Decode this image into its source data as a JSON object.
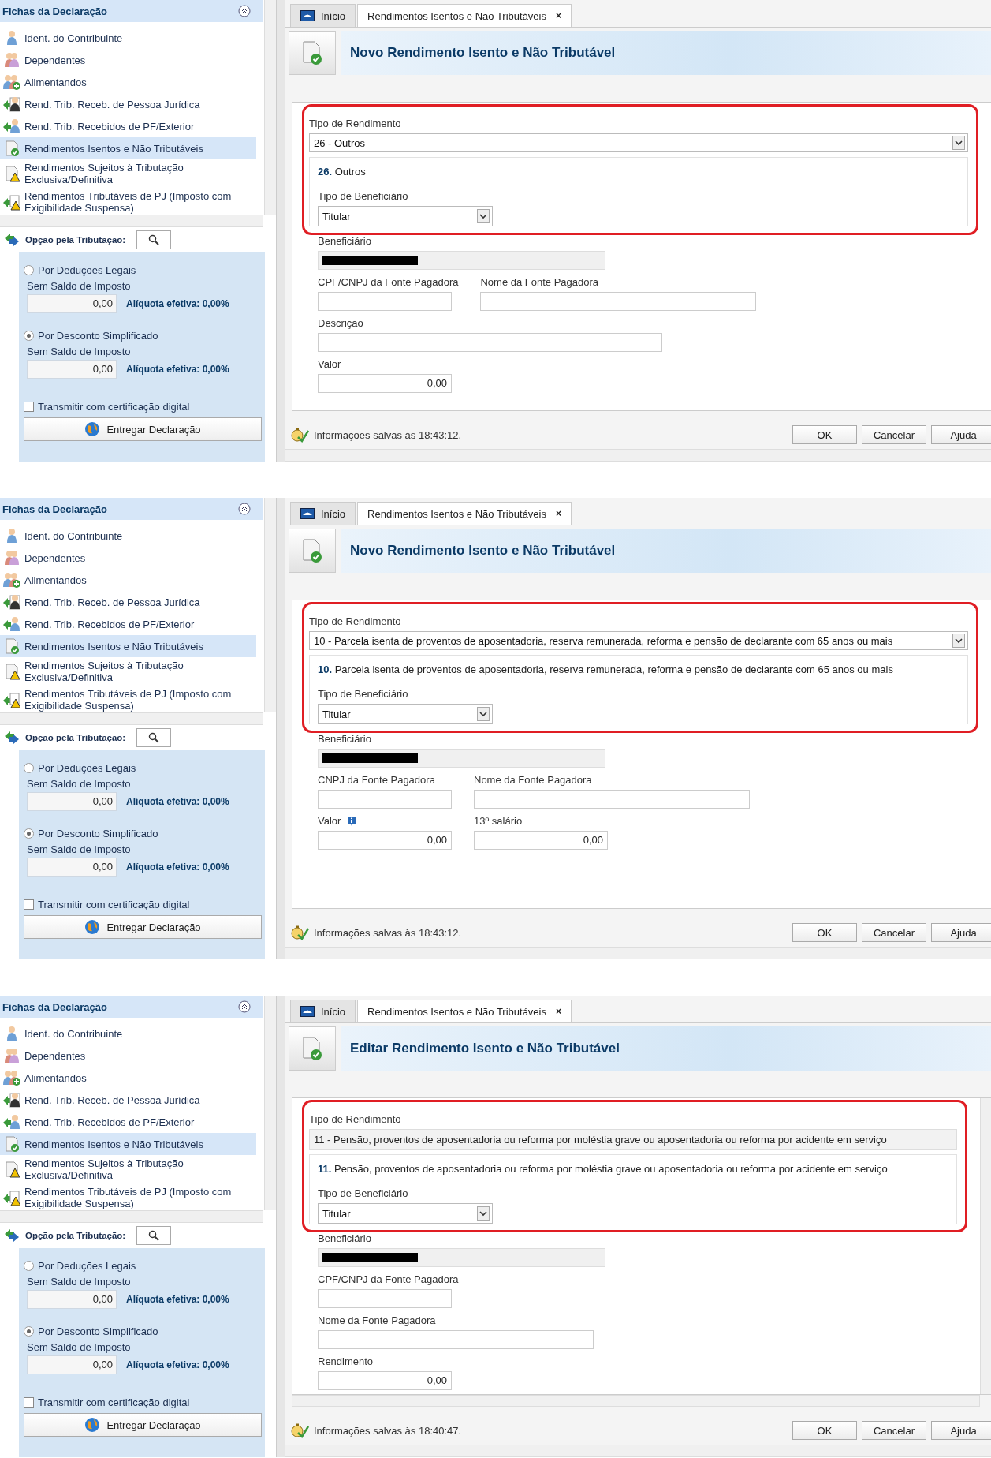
{
  "screens": [
    {
      "sidebar": {
        "title": "Fichas da Declaração",
        "items": [
          {
            "label": "Ident. do Contribuinte",
            "selected": false
          },
          {
            "label": "Dependentes",
            "selected": false
          },
          {
            "label": "Alimentandos",
            "selected": false
          },
          {
            "label": "Rend. Trib. Receb. de Pessoa Jurídica",
            "selected": false
          },
          {
            "label": "Rend. Trib. Recebidos de PF/Exterior",
            "selected": false
          },
          {
            "label": "Rendimentos Isentos e Não Tributáveis",
            "selected": true
          },
          {
            "label": "Rendimentos Sujeitos à Tributação Exclusiva/Definitiva",
            "selected": false
          },
          {
            "label": "Rendimentos Tributáveis de PJ (Imposto com Exigibilidade Suspensa)",
            "selected": false
          }
        ]
      },
      "tax_option": {
        "label": "Opção pela Tributação:",
        "options": [
          {
            "label": "Por Deduções Legais",
            "selected": false,
            "balance_label": "Sem Saldo de Imposto",
            "value": "0,00",
            "rate": "Alíquota efetiva: 0,00%"
          },
          {
            "label": "Por Desconto Simplificado",
            "selected": true,
            "balance_label": "Sem Saldo de Imposto",
            "value": "0,00",
            "rate": "Alíquota efetiva: 0,00%"
          }
        ],
        "certificate": {
          "label": "Transmitir com certificação digital",
          "checked": false
        },
        "submit": "Entregar Declaração"
      },
      "tabs": [
        {
          "label": "Início",
          "selected": false
        },
        {
          "label": "Rendimentos Isentos e Não Tributáveis",
          "selected": true,
          "close": "×"
        }
      ],
      "header": {
        "title": "Novo Rendimento Isento e Não Tributável"
      },
      "form": {
        "income_type": {
          "label": "Tipo de Rendimento",
          "value": "26 - Outros",
          "dropdown": true
        },
        "description": "**26.** Outros",
        "beneficiary_type": {
          "label": "Tipo de Beneficiário",
          "value": "Titular"
        },
        "rows": [
          [
            {
              "label": "Beneficiário",
              "kind": "masked"
            }
          ],
          [
            {
              "label": "CPF/CNPJ da Fonte Pagadora",
              "kind": "code"
            },
            {
              "label": "Nome da Fonte Pagadora",
              "kind": "name"
            }
          ],
          [
            {
              "label": "Descrição",
              "kind": "text"
            }
          ],
          [
            {
              "label": "Valor",
              "kind": "amount",
              "value": "0,00"
            }
          ]
        ],
        "scrollable": false
      },
      "status": "Informações salvas às 18:43:12.",
      "buttons": [
        "OK",
        "Cancelar",
        "Ajuda"
      ]
    },
    {
      "sidebar": {
        "title": "Fichas da Declaração",
        "items": [
          {
            "label": "Ident. do Contribuinte",
            "selected": false
          },
          {
            "label": "Dependentes",
            "selected": false
          },
          {
            "label": "Alimentandos",
            "selected": false
          },
          {
            "label": "Rend. Trib. Receb. de Pessoa Jurídica",
            "selected": false
          },
          {
            "label": "Rend. Trib. Recebidos de PF/Exterior",
            "selected": false
          },
          {
            "label": "Rendimentos Isentos e Não Tributáveis",
            "selected": true
          },
          {
            "label": "Rendimentos Sujeitos à Tributação Exclusiva/Definitiva",
            "selected": false
          },
          {
            "label": "Rendimentos Tributáveis de PJ (Imposto com Exigibilidade Suspensa)",
            "selected": false
          }
        ]
      },
      "tax_option": {
        "label": "Opção pela Tributação:",
        "options": [
          {
            "label": "Por Deduções Legais",
            "selected": false,
            "balance_label": "Sem Saldo de Imposto",
            "value": "0,00",
            "rate": "Alíquota efetiva: 0,00%"
          },
          {
            "label": "Por Desconto Simplificado",
            "selected": true,
            "balance_label": "Sem Saldo de Imposto",
            "value": "0,00",
            "rate": "Alíquota efetiva: 0,00%"
          }
        ],
        "certificate": {
          "label": "Transmitir com certificação digital",
          "checked": false
        },
        "submit": "Entregar Declaração"
      },
      "tabs": [
        {
          "label": "Início",
          "selected": false
        },
        {
          "label": "Rendimentos Isentos e Não Tributáveis",
          "selected": true,
          "close": "×"
        }
      ],
      "header": {
        "title": "Novo Rendimento Isento e Não Tributável"
      },
      "form": {
        "income_type": {
          "label": "Tipo de Rendimento",
          "value": "10 - Parcela isenta de proventos de aposentadoria, reserva remunerada, reforma e pensão de declarante com 65 anos ou mais",
          "dropdown": true
        },
        "description": "**10.** Parcela isenta de proventos de aposentadoria, reserva remunerada, reforma e pensão de declarante com 65 anos ou mais",
        "beneficiary_type": {
          "label": "Tipo de Beneficiário",
          "value": "Titular"
        },
        "rows": [
          [
            {
              "label": "Beneficiário",
              "kind": "masked"
            }
          ],
          [
            {
              "label": "CNPJ da Fonte Pagadora",
              "kind": "code"
            },
            {
              "label": "Nome da Fonte Pagadora",
              "kind": "name"
            }
          ],
          [
            {
              "label": "Valor",
              "kind": "amount",
              "value": "0,00",
              "info": true
            },
            {
              "label": "13º salário",
              "kind": "amount",
              "value": "0,00"
            }
          ]
        ],
        "scrollable": false
      },
      "status": "Informações salvas às 18:43:12.",
      "buttons": [
        "OK",
        "Cancelar",
        "Ajuda"
      ]
    },
    {
      "sidebar": {
        "title": "Fichas da Declaração",
        "items": [
          {
            "label": "Ident. do Contribuinte",
            "selected": false
          },
          {
            "label": "Dependentes",
            "selected": false
          },
          {
            "label": "Alimentandos",
            "selected": false
          },
          {
            "label": "Rend. Trib. Receb. de Pessoa Jurídica",
            "selected": false
          },
          {
            "label": "Rend. Trib. Recebidos de PF/Exterior",
            "selected": false
          },
          {
            "label": "Rendimentos Isentos e Não Tributáveis",
            "selected": true
          },
          {
            "label": "Rendimentos Sujeitos à Tributação Exclusiva/Definitiva",
            "selected": false
          },
          {
            "label": "Rendimentos Tributáveis de PJ (Imposto com Exigibilidade Suspensa)",
            "selected": false
          }
        ]
      },
      "tax_option": {
        "label": "Opção pela Tributação:",
        "options": [
          {
            "label": "Por Deduções Legais",
            "selected": false,
            "balance_label": "Sem Saldo de Imposto",
            "value": "0,00",
            "rate": "Alíquota efetiva: 0,00%"
          },
          {
            "label": "Por Desconto Simplificado",
            "selected": true,
            "balance_label": "Sem Saldo de Imposto",
            "value": "0,00",
            "rate": "Alíquota efetiva: 0,00%"
          }
        ],
        "certificate": {
          "label": "Transmitir com certificação digital",
          "checked": false
        },
        "submit": "Entregar Declaração"
      },
      "tabs": [
        {
          "label": "Início",
          "selected": false
        },
        {
          "label": "Rendimentos Isentos e Não Tributáveis",
          "selected": true,
          "close": "×"
        }
      ],
      "header": {
        "title": "Editar Rendimento Isento e Não Tributável"
      },
      "form": {
        "income_type": {
          "label": "Tipo de Rendimento",
          "value": "11 - Pensão, proventos de aposentadoria ou reforma por moléstia grave ou aposentadoria ou reforma por acidente  em serviço",
          "dropdown": false
        },
        "description": "**11.** Pensão, proventos de aposentadoria ou reforma por moléstia grave ou aposentadoria ou reforma por acidente em serviço",
        "beneficiary_type": {
          "label": "Tipo de Beneficiário",
          "value": "Titular"
        },
        "rows": [
          [
            {
              "label": "Beneficiário",
              "kind": "masked"
            }
          ],
          [
            {
              "label": "CPF/CNPJ da Fonte Pagadora",
              "kind": "code"
            }
          ],
          [
            {
              "label": "Nome da Fonte Pagadora",
              "kind": "name"
            }
          ],
          [
            {
              "label": "Rendimento",
              "kind": "amount",
              "value": "0,00"
            }
          ]
        ],
        "scrollable": true
      },
      "status": "Informações salvas às 18:40:47.",
      "buttons": [
        "OK",
        "Cancelar",
        "Ajuda"
      ]
    }
  ]
}
